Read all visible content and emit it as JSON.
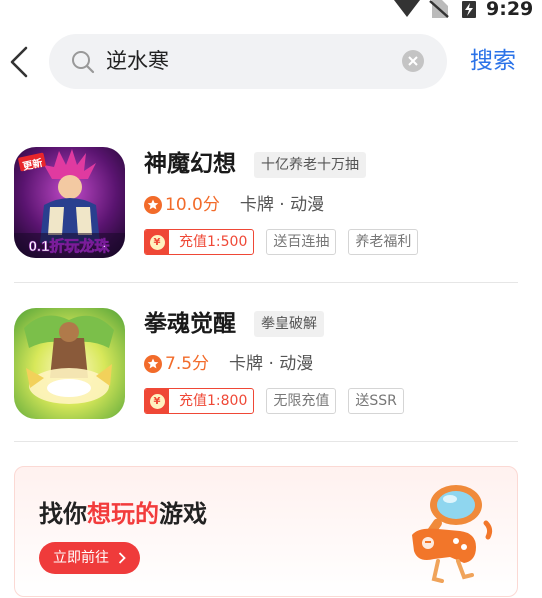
{
  "status_bar": {
    "time": "9:29"
  },
  "search": {
    "query": "逆水寒",
    "submit_label": "搜索"
  },
  "games": [
    {
      "name": "神魔幻想",
      "tag": "十亿养老十万抽",
      "score": "10.0分",
      "genre": "卡牌 · 动漫",
      "recharge": "充值1:500",
      "perks": [
        "送百连抽",
        "养老福利"
      ],
      "icon_caption": "0.1折玩龙珠",
      "icon_badge": "更新"
    },
    {
      "name": "拳魂觉醒",
      "tag": "拳皇破解",
      "score": "7.5分",
      "genre": "卡牌 · 动漫",
      "recharge": "充值1:800",
      "perks": [
        "无限充值",
        "送SSR"
      ]
    }
  ],
  "banner": {
    "title_prefix": "找你",
    "title_highlight": "想玩的",
    "title_suffix": "游戏",
    "button_label": "立即前往"
  },
  "colors": {
    "accent_blue": "#2b73e8",
    "accent_red": "#ef3b3b",
    "score_orange": "#f26b2a"
  }
}
